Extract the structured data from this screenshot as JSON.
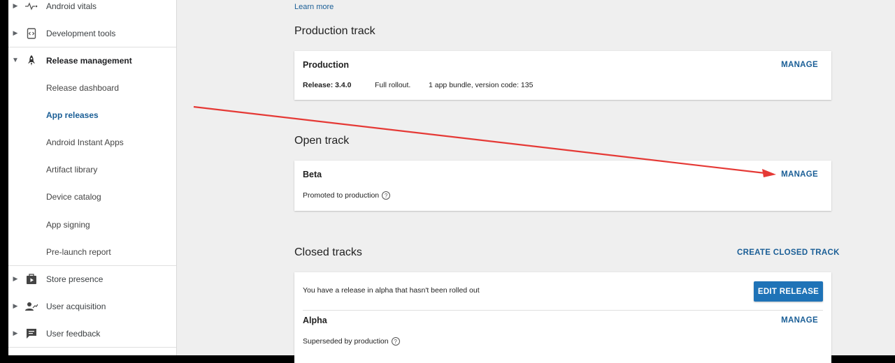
{
  "sidebar": {
    "items": [
      {
        "label": "Android vitals",
        "icon": "vitals-pulse-icon"
      },
      {
        "label": "Development tools",
        "icon": "dev-tools-icon"
      },
      {
        "label": "Release management",
        "icon": "rocket-icon"
      },
      {
        "label": "Release dashboard"
      },
      {
        "label": "App releases"
      },
      {
        "label": "Android Instant Apps"
      },
      {
        "label": "Artifact library"
      },
      {
        "label": "Device catalog"
      },
      {
        "label": "App signing"
      },
      {
        "label": "Pre-launch report"
      },
      {
        "label": "Store presence",
        "icon": "store-play-icon"
      },
      {
        "label": "User acquisition",
        "icon": "user-acquisition-icon"
      },
      {
        "label": "User feedback",
        "icon": "feedback-icon"
      }
    ]
  },
  "main": {
    "learn_more": "Learn more",
    "production": {
      "section_title": "Production track",
      "card_title": "Production",
      "manage": "MANAGE",
      "release": "Release: 3.4.0",
      "rollout": "Full rollout.",
      "bundle": "1 app bundle, version code: 135"
    },
    "open": {
      "section_title": "Open track",
      "card_title": "Beta",
      "manage": "MANAGE",
      "status": "Promoted to production"
    },
    "closed": {
      "section_title": "Closed tracks",
      "create_button": "CREATE CLOSED TRACK",
      "notice": "You have a release in alpha that hasn't been rolled out",
      "edit_button": "EDIT RELEASE",
      "card_title": "Alpha",
      "manage": "MANAGE",
      "status": "Superseded by production"
    }
  },
  "colors": {
    "accent": "#1a5e96",
    "primary_button": "#1f73b7",
    "annotation_arrow": "#e53935"
  }
}
